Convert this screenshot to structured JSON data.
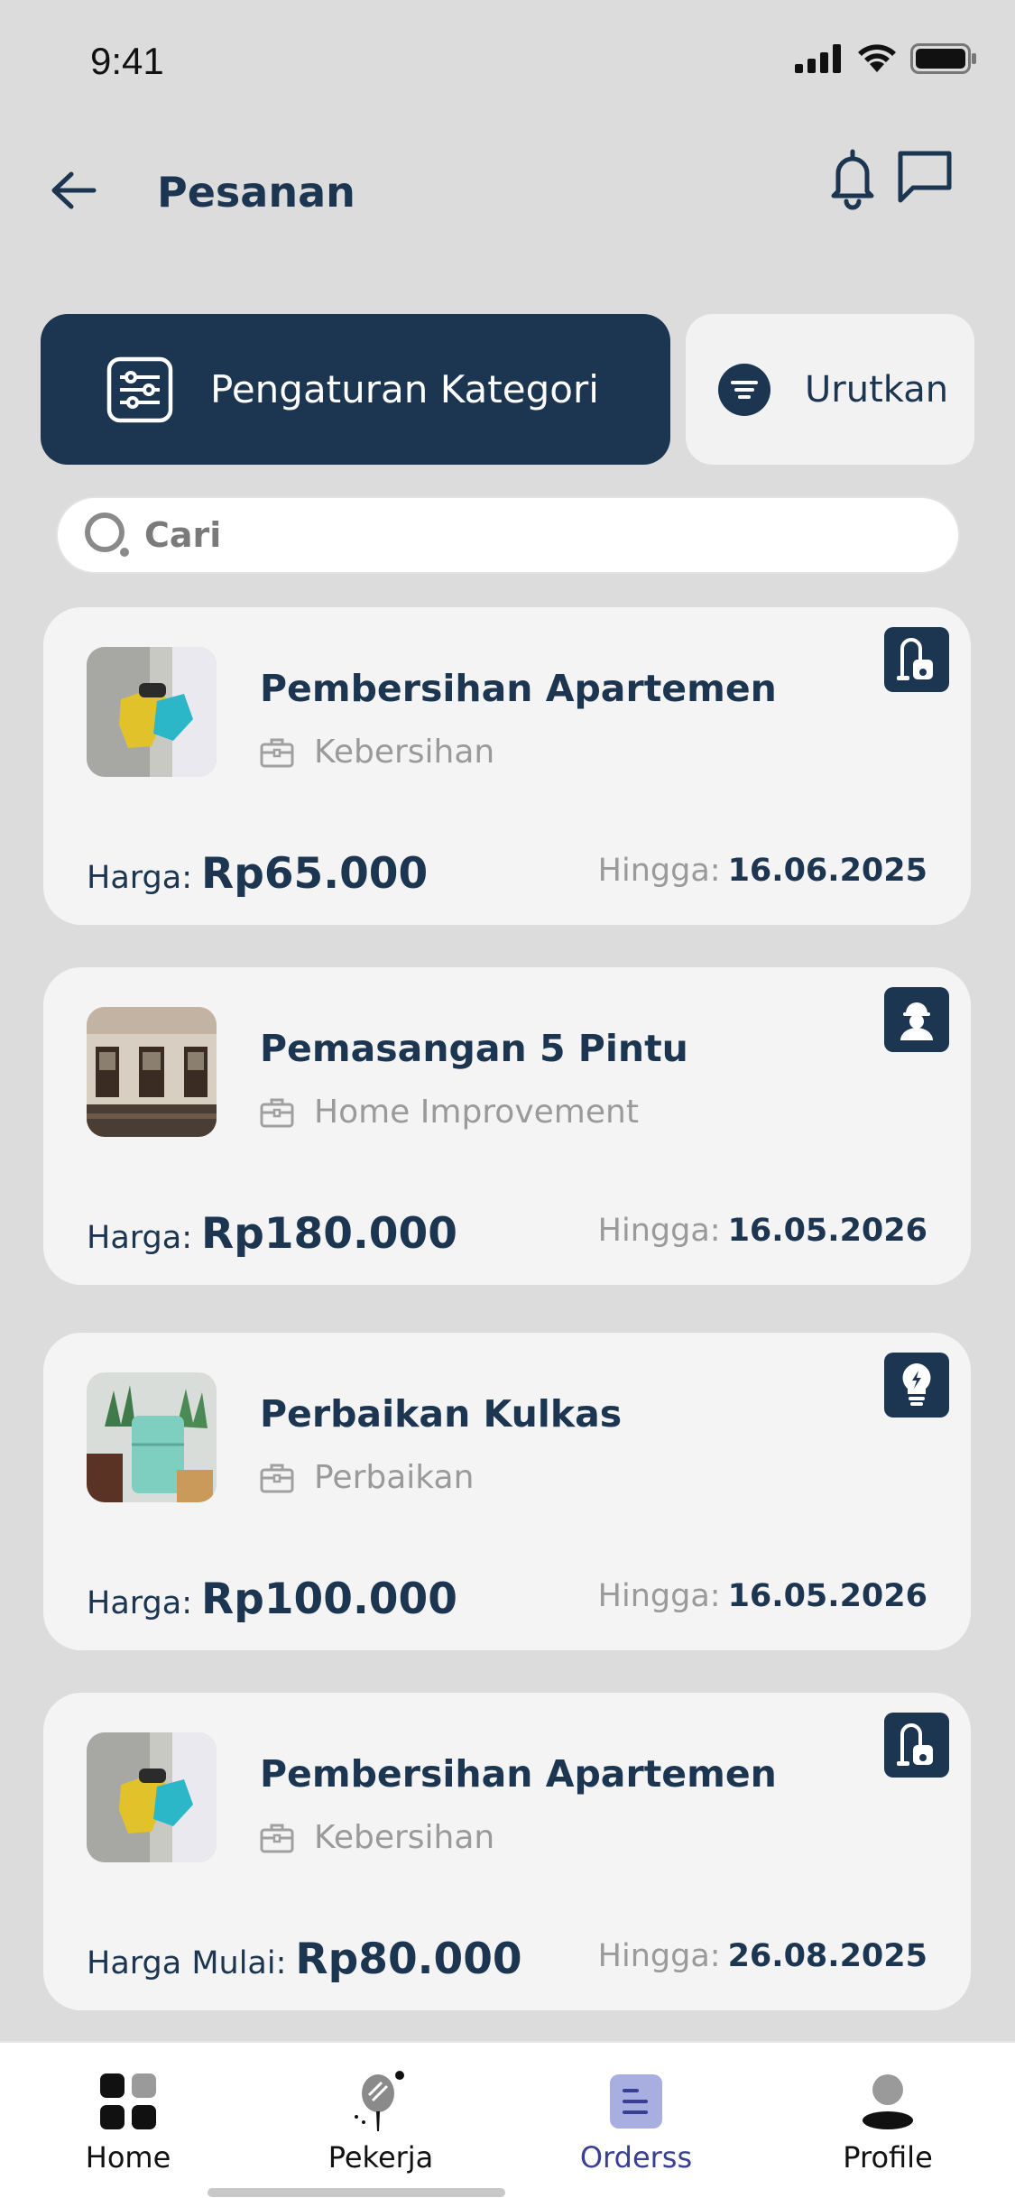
{
  "status_bar": {
    "time": "9:41"
  },
  "header": {
    "title": "Pesanan"
  },
  "actions": {
    "category_label": "Pengaturan Kategori",
    "sort_label": "Urutkan"
  },
  "search": {
    "placeholder": "Cari"
  },
  "orders": [
    {
      "title": "Pembersihan Apartemen",
      "category": "Kebersihan",
      "price_label": "Harga:",
      "price": "Rp65.000",
      "until_label": "Hingga:",
      "until": "16.06.2025",
      "badge_icon": "vacuum-icon"
    },
    {
      "title": "Pemasangan 5 Pintu",
      "category": "Home Improvement",
      "price_label": "Harga:",
      "price": "Rp180.000",
      "until_label": "Hingga:",
      "until": "16.05.2026",
      "badge_icon": "worker-icon"
    },
    {
      "title": "Perbaikan Kulkas",
      "category": "Perbaikan",
      "price_label": "Harga:",
      "price": "Rp100.000",
      "until_label": "Hingga:",
      "until": "16.05.2026",
      "badge_icon": "bulb-icon"
    },
    {
      "title": "Pembersihan Apartemen",
      "category": "Kebersihan",
      "price_label": "Harga Mulai:",
      "price": "Rp80.000",
      "until_label": "Hingga:",
      "until": "26.08.2025",
      "badge_icon": "vacuum-icon"
    }
  ],
  "bottom_nav": [
    {
      "label": "Home",
      "icon": "grid-icon",
      "active": false
    },
    {
      "label": "Pekerja",
      "icon": "worker-tool-icon",
      "active": false
    },
    {
      "label": "Orderss",
      "icon": "orders-icon",
      "active": true
    },
    {
      "label": "Profile",
      "icon": "user-icon",
      "active": false
    }
  ],
  "colors": {
    "primary": "#1c3550",
    "background": "#dcdcdc",
    "card": "#f4f4f4",
    "nav_active": "#3b3f94"
  }
}
